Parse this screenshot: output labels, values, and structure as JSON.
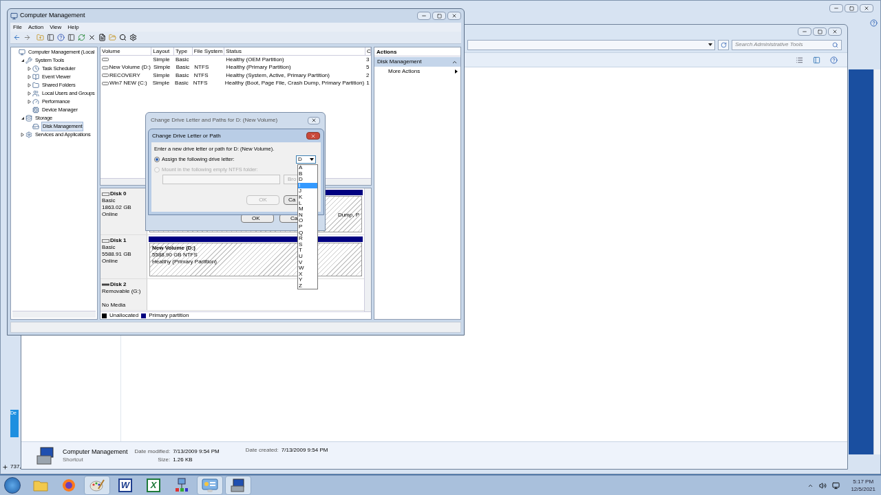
{
  "desktop": {
    "icon_label": "De"
  },
  "paint_window": {
    "status": "737,"
  },
  "explorer": {
    "search": {
      "placeholder": "Search Administrative Tools"
    },
    "details": {
      "name": "Computer Management",
      "type": "Shortcut",
      "fields": [
        {
          "label": "Date modified:",
          "value": "7/13/2009 9:54 PM"
        },
        {
          "label": "Size:",
          "value": "1.26 KB"
        },
        {
          "label": "Date created:",
          "value": "7/13/2009 9:54 PM"
        }
      ]
    }
  },
  "computer_management": {
    "title": "Computer Management",
    "menu": [
      "File",
      "Action",
      "View",
      "Help"
    ],
    "tree": [
      {
        "label": "Computer Management (Local",
        "kind": "computer",
        "selected": false,
        "children": [
          {
            "label": "System Tools",
            "kind": "tools",
            "expanded": true,
            "selected": false,
            "children": [
              {
                "label": "Task Scheduler",
                "kind": "clock",
                "expanded": false,
                "selected": false
              },
              {
                "label": "Event Viewer",
                "kind": "log",
                "expanded": false,
                "selected": false
              },
              {
                "label": "Shared Folders",
                "kind": "folder",
                "expanded": false,
                "selected": false
              },
              {
                "label": "Local Users and Groups",
                "kind": "users",
                "expanded": false,
                "selected": false
              },
              {
                "label": "Performance",
                "kind": "gauge",
                "expanded": false,
                "selected": false
              },
              {
                "label": "Device Manager",
                "kind": "device",
                "selected": false
              }
            ]
          },
          {
            "label": "Storage",
            "kind": "storage",
            "expanded": true,
            "selected": false,
            "children": [
              {
                "label": "Disk Management",
                "kind": "disk",
                "selected": true
              }
            ]
          },
          {
            "label": "Services and Applications",
            "kind": "services",
            "expanded": false,
            "selected": false
          }
        ]
      }
    ],
    "volumes": {
      "columns": [
        "Volume",
        "Layout",
        "Type",
        "File System",
        "Status",
        "C"
      ],
      "rows": [
        {
          "layout": "Simple",
          "type": "Basic",
          "status": "Healthy (OEM Partition)",
          "c": "3"
        },
        {
          "volume": "New Volume (D:)",
          "layout": "Simple",
          "type": "Basic",
          "fs": "NTFS",
          "status": "Healthy (Primary Partition)",
          "c": "5"
        },
        {
          "volume": "RECOVERY",
          "layout": "Simple",
          "type": "Basic",
          "fs": "NTFS",
          "status": "Healthy (System, Active, Primary Partition)",
          "c": "2"
        },
        {
          "volume": "Win7 NEW (C:)",
          "layout": "Simple",
          "type": "Basic",
          "fs": "NTFS",
          "status": "Healthy (Boot, Page File, Crash Dump, Primary Partition)",
          "c": "1"
        }
      ]
    },
    "disks": [
      {
        "name": "Disk 0",
        "kind": "fixed",
        "lines": [
          "Basic",
          "1863.02 GB",
          "Online"
        ],
        "partition": {
          "lines": [
            "Dump, P"
          ]
        }
      },
      {
        "name": "Disk 1",
        "kind": "fixed",
        "lines": [
          "Basic",
          "5588.91 GB",
          "Online"
        ],
        "partition": {
          "title": "New Volume  (D:)",
          "lines": [
            "5588.90 GB NTFS",
            "Healthy (Primary Partition)"
          ]
        }
      },
      {
        "name": "Disk 2",
        "kind": "removable",
        "lines": [
          "Removable (G:)",
          "No Media"
        ]
      }
    ],
    "legend": [
      {
        "label": "Unallocated",
        "color": "#000000"
      },
      {
        "label": "Primary partition",
        "color": "#000080"
      }
    ],
    "actions": {
      "title": "Actions",
      "section": "Disk Management",
      "items": [
        "More Actions"
      ]
    }
  },
  "paths_dialog": {
    "title": "Change Drive Letter and Paths for D: (New Volume)",
    "buttons": [
      "OK",
      "Ca"
    ]
  },
  "letter_dialog": {
    "title": "Change Drive Letter or Path",
    "prompt": "Enter a new drive letter or path for D: (New Volume).",
    "options": [
      {
        "label": "Assign the following drive letter:",
        "selected": true,
        "disabled": false
      },
      {
        "label": "Mount in the following empty NTFS folder:",
        "selected": false,
        "disabled": true
      }
    ],
    "browse": "Bro",
    "ok": {
      "label": "OK",
      "disabled": true
    },
    "cancel": "Ca",
    "drive": "D",
    "letters": [
      {
        "label": "A",
        "selected": false
      },
      {
        "label": "B",
        "selected": false
      },
      {
        "label": "D",
        "selected": false
      },
      {
        "label": "I",
        "selected": true
      },
      {
        "label": "J",
        "selected": false
      },
      {
        "label": "K",
        "selected": false
      },
      {
        "label": "L",
        "selected": false
      },
      {
        "label": "M",
        "selected": false
      },
      {
        "label": "N",
        "selected": false
      },
      {
        "label": "O",
        "selected": false
      },
      {
        "label": "P",
        "selected": false
      },
      {
        "label": "Q",
        "selected": false
      },
      {
        "label": "R",
        "selected": false
      },
      {
        "label": "S",
        "selected": false
      },
      {
        "label": "T",
        "selected": false
      },
      {
        "label": "U",
        "selected": false
      },
      {
        "label": "V",
        "selected": false
      },
      {
        "label": "W",
        "selected": false
      },
      {
        "label": "X",
        "selected": false
      },
      {
        "label": "Y",
        "selected": false
      },
      {
        "label": "Z",
        "selected": false
      }
    ]
  },
  "taskbar": {
    "apps": [
      {
        "kind": "explorer",
        "active": false
      },
      {
        "kind": "firefox",
        "active": false
      },
      {
        "kind": "paint",
        "active": true
      },
      {
        "kind": "word",
        "label": "W",
        "active": false
      },
      {
        "kind": "excel",
        "label": "X",
        "active": false
      },
      {
        "kind": "network",
        "active": false
      },
      {
        "kind": "control",
        "active": true
      },
      {
        "kind": "management",
        "active": true
      }
    ],
    "time": "5:17 PM",
    "date": "12/5/2021"
  }
}
